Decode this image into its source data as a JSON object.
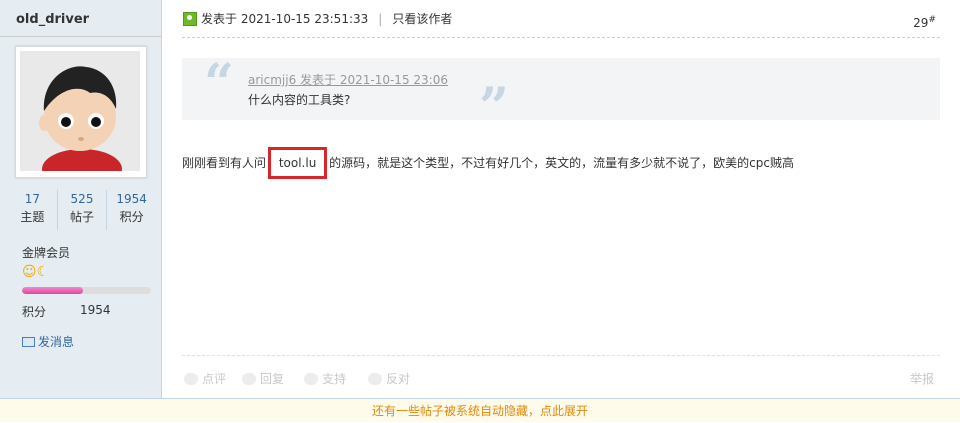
{
  "user": {
    "name": "old_driver",
    "stats": [
      {
        "value": "17",
        "label": "主题"
      },
      {
        "value": "525",
        "label": "帖子"
      },
      {
        "value": "1954",
        "label": "积分"
      }
    ],
    "rank": "金牌会员",
    "medals_icon": "smile-moon-icon",
    "progress_fraction": 0.47,
    "points_label": "积分",
    "points_value": "1954",
    "message_label": "发消息"
  },
  "post": {
    "posted_at": "发表于 2021-10-15 23:51:33",
    "author_only": "只看该作者",
    "floor_num": "29",
    "floor_mark": "#",
    "quote": {
      "header": "aricmjj6 发表于 2021-10-15 23:06",
      "body": "什么内容的工具类?"
    },
    "content_before": "刚刚看到有人问 ",
    "content_highlight": "tool.lu",
    "content_after": " 的源码，就是这个类型，不过有好几个，英文的，流量有多少就不说了，欧美的cpc贼高"
  },
  "actions": {
    "rate": "点评",
    "reply": "回复",
    "support": "支持",
    "oppose": "反对",
    "report": "举报"
  },
  "notice": "还有一些帖子被系统自动隐藏，点此展开",
  "colors": {
    "sidebar_bg": "#e5edf2",
    "highlight_border": "#d9262b",
    "link": "#336699",
    "notice_text": "#e08a0a"
  }
}
